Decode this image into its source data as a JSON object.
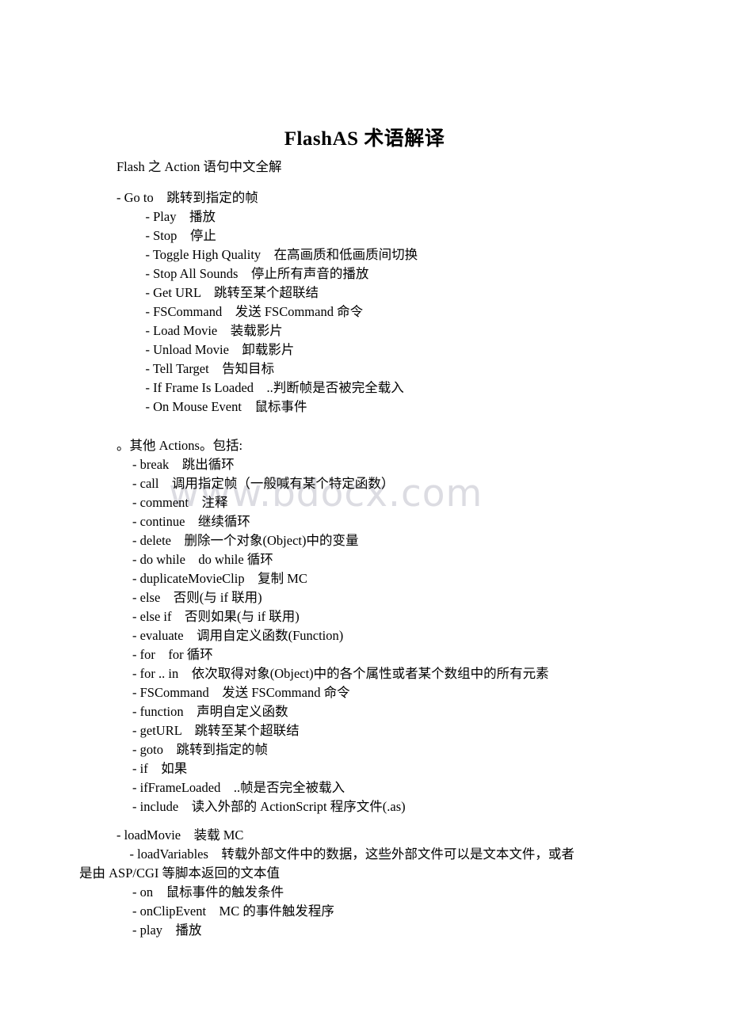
{
  "document": {
    "title": "FlashAS 术语解译",
    "intro": "Flash 之 Action 语句中文全解",
    "watermark": "www.bdocx.com"
  },
  "section_basic_actions": {
    "lines": [
      "- Go to　跳转到指定的帧",
      "　- Play　播放",
      "　- Stop　停止",
      "　- Toggle High Quality　在高画质和低画质间切换",
      "　- Stop All Sounds　停止所有声音的播放",
      "　- Get URL　跳转至某个超联结",
      "　- FSCommand　发送 FSCommand 命令",
      "　- Load Movie　装载影片",
      "　- Unload Movie　卸载影片",
      "　- Tell Target　告知目标",
      "　- If Frame Is Loaded　..判断帧是否被完全载入",
      "　- On Mouse Event　鼠标事件"
    ]
  },
  "section_other_actions": {
    "heading": "。其他 Actions。包括:",
    "lines": [
      "- break　跳出循环",
      "- call　调用指定帧（一般喊有某个特定函数）",
      "- comment　注释",
      "- continue　继续循环",
      "- delete　删除一个对象(Object)中的变量",
      "- do while　do while 循环",
      "- duplicateMovieClip　复制 MC",
      "- else　否则(与 if 联用)",
      "- else if　否则如果(与 if 联用)",
      "- evaluate　调用自定义函数(Function)",
      "- for　for 循环",
      "- for .. in　依次取得对象(Object)中的各个属性或者某个数组中的所有元素",
      "- FSCommand　发送 FSCommand 命令",
      "- function　声明自定义函数",
      "- getURL　跳转至某个超联结",
      "- goto　跳转到指定的帧",
      "- if　如果",
      "- ifFrameLoaded　..帧是否完全被载入",
      "- include　读入外部的 ActionScript 程序文件(.as)"
    ]
  },
  "section_load": {
    "lines": [
      "- loadMovie　装载 MC",
      "　- loadVariables　转载外部文件中的数据，这些外部文件可以是文本文件，或者"
    ],
    "wrapped_continuation": "是由 ASP/CGI 等脚本返回的文本值"
  },
  "section_events": {
    "lines": [
      "- on　鼠标事件的触发条件",
      "- onClipEvent　MC 的事件触发程序",
      "- play　播放"
    ]
  }
}
